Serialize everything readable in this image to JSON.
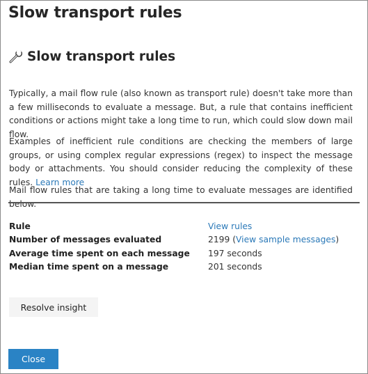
{
  "header": {
    "title": "Slow transport rules"
  },
  "section": {
    "icon": "wrench-icon",
    "title": "Slow transport rules"
  },
  "description": {
    "paragraph1": "Typically, a mail flow rule (also known as transport rule) doesn't take more than a few milliseconds to evaluate a message. But, a rule that contains inefficient conditions or actions might take a long time to run, which could slow down mail flow.",
    "paragraph2_text": "Examples of inefficient rule conditions are checking the members of large groups, or using complex regular expressions (regex) to inspect the message body or attachments. You should consider reducing the complexity of these rules.",
    "paragraph2_link": "Learn more",
    "paragraph3": "Mail flow rules that are taking a long time to evaluate messages are identified below."
  },
  "details": {
    "rule_label": "Rule",
    "rule_link": "View rules",
    "messages_label": "Number of messages evaluated",
    "messages_value": "2199",
    "messages_link": "View sample messages",
    "avg_label": "Average time spent on each message",
    "avg_value": "197 seconds",
    "median_label": "Median time spent on a message",
    "median_value": "201 seconds"
  },
  "actions": {
    "resolve_label": "Resolve insight",
    "close_label": "Close"
  },
  "colors": {
    "link": "#2b79b8",
    "primary_button": "#2a83c5",
    "secondary_button": "#f4f4f4"
  }
}
